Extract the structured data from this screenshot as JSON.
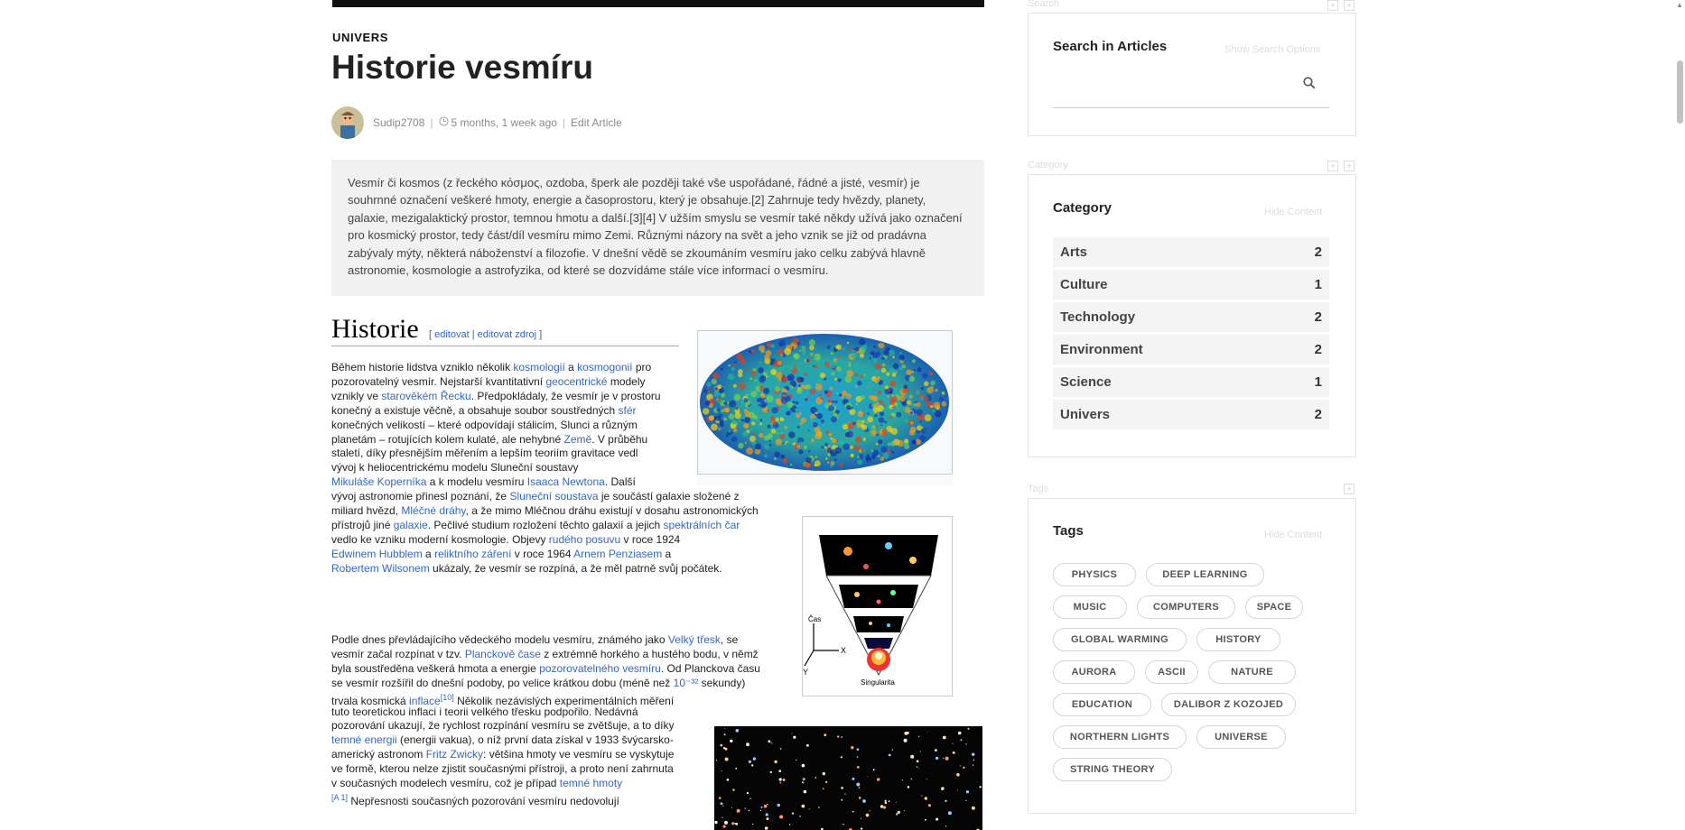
{
  "article": {
    "category": "UNIVERS",
    "title": "Historie vesmíru",
    "author": "Sudip2708",
    "time": "5 months, 1 week ago",
    "edit_link": "Edit Article",
    "summary": "Vesmír či kosmos (z řeckého κόσμος, ozdoba, šperk ale později také vše uspořádané, řádné a jisté, vesmír) je souhrnné označení veškeré hmoty, energie a časoprostoru, který je obsahuje.[2] Zahrnuje tedy hvězdy, planety, galaxie, mezigalaktický prostor, temnou hmotu a další.[3][4] V užším smyslu se vesmír také někdy užívá jako označení pro kosmický prostor, tedy část/díl vesmíru mimo Zemi. Různými názory na svět a jeho vznik se již od pradávna zabývaly mýty, některá náboženství a filozofie. V dnešní vědě se zkoumáním vesmíru jako celku zabývá hlavně astronomie, kosmologie a astrofyzika, od které se dozvídáme stále více informací o vesmíru."
  },
  "wiki": {
    "heading": "Historie",
    "edit_open": "[ ",
    "edit_label": "editovat",
    "edit_sep": " | ",
    "edit_source": "editovat zdroj",
    "edit_close": " ]",
    "p1": [
      [
        [
          "Během historie lidstva vzniklo několik ",
          0
        ],
        [
          "kosmologií",
          1
        ],
        [
          " a ",
          0
        ],
        [
          "kosmogonií",
          1
        ],
        [
          " pro",
          0
        ]
      ],
      [
        [
          "pozorovatelný vesmír. Nejstarší kvantitativní ",
          0
        ],
        [
          "geocentrické",
          1
        ],
        [
          " modely",
          0
        ]
      ],
      [
        [
          "vznikly ve ",
          0
        ],
        [
          "starověkém Řecku",
          1
        ],
        [
          ". Předpokládaly, že vesmír je v prostoru",
          0
        ]
      ],
      [
        [
          "konečný a existuje věčně, a obsahuje soubor soustředných ",
          0
        ],
        [
          "sfér",
          1
        ]
      ],
      [
        [
          " konečných velikostí – které odpovídají stálicím, Slunci a různým",
          0
        ]
      ],
      [
        [
          "planetám – rotujících kolem kulaté, ale nehybné ",
          0
        ],
        [
          "Země",
          1
        ],
        [
          ". V průběhu",
          0
        ]
      ],
      [
        [
          "staletí, díky přesnějším měřením a lepším teoriím gravitace vedl",
          0
        ]
      ],
      [
        [
          "vývoj k heliocentrickému modelu Sluneční soustavy",
          0
        ]
      ],
      [
        [
          "Mikuláše Koperníka",
          1
        ],
        [
          " a k modelu vesmíru ",
          0
        ],
        [
          "Isaaca Newtona",
          1
        ],
        [
          ". Další",
          0
        ]
      ],
      [
        [
          "vývoj astronomie přinesl poznání, že ",
          0
        ],
        [
          "Sluneční soustava",
          1
        ],
        [
          " je součástí galaxie složené z",
          0
        ]
      ],
      [
        [
          "miliard hvězd, ",
          0
        ],
        [
          "Mléčné dráhy",
          1
        ],
        [
          ", a že mimo Mléčnou dráhu existují v dosahu astronomických",
          0
        ]
      ],
      [
        [
          "přístrojů jiné ",
          0
        ],
        [
          "galaxie",
          1
        ],
        [
          ". Pečlivé studium rozložení těchto galaxií a jejich ",
          0
        ],
        [
          "spektrálních čar",
          1
        ]
      ],
      [
        [
          " vedlo ke vzniku moderní kosmologie. Objevy ",
          0
        ],
        [
          "rudého posuvu",
          1
        ],
        [
          " v roce 1924",
          0
        ]
      ],
      [
        [
          "Edwinem Hubblem",
          1
        ],
        [
          " a ",
          0
        ],
        [
          "reliktního záření",
          1
        ],
        [
          " v roce 1964 ",
          0
        ],
        [
          "Arnem Penziasem",
          1
        ],
        [
          " a",
          0
        ]
      ],
      [
        [
          "Robertem Wilsonem",
          1
        ],
        [
          " ukázaly, že vesmír se rozpíná, a že měl patrně svůj počátek.",
          0
        ]
      ]
    ],
    "p2": [
      [
        [
          "Podle dnes převládajícího vědeckého modelu vesmíru, známého jako ",
          0
        ],
        [
          "Velký třesk",
          1
        ],
        [
          ", se",
          0
        ]
      ],
      [
        [
          "vesmír začal rozpínat v tzv. ",
          0
        ],
        [
          "Planckově čase",
          1
        ],
        [
          " z extrémně horkého a hustého bodu, v němž",
          0
        ]
      ],
      [
        [
          "byla soustředěna veškerá hmota a energie ",
          0
        ],
        [
          "pozorovatelného vesmíru",
          1
        ],
        [
          ". Od Planckova času",
          0
        ]
      ],
      [
        [
          "se vesmír rozšířil do dnešní podoby, po velice krátkou dobu (méně než ",
          0
        ],
        [
          "10⁻³²",
          1
        ],
        [
          " sekundy)",
          0
        ]
      ],
      [
        [
          "trvala kosmická ",
          0
        ],
        [
          "inflace",
          1
        ],
        [
          "[10]",
          2
        ],
        [
          " Několik nezávislých experimentálních měření",
          0
        ]
      ],
      [
        [
          "tuto teoretickou inflaci i teorii velkého třesku podpořilo. Nedávná",
          0
        ]
      ],
      [
        [
          "pozorování ukazují, že rychlost rozpínání vesmíru se zvětšuje, a to díky",
          0
        ]
      ],
      [
        [
          "temné energii",
          1
        ],
        [
          " (energii vakua), o níž první data získal v 1933 švýcarsko-",
          0
        ]
      ],
      [
        [
          "americký astronom ",
          0
        ],
        [
          "Fritz Zwicky",
          1
        ],
        [
          ": většina hmoty ve vesmíru se vyskytuje",
          0
        ]
      ],
      [
        [
          "ve formě, kterou nelze zjistit současnými přístroji, a proto není zahrnuta",
          0
        ]
      ],
      [
        [
          "v současných modelech vesmíru, což je případ ",
          0
        ],
        [
          "temné hmoty",
          1
        ]
      ],
      [
        [
          " ",
          0
        ],
        [
          "[A 1]",
          2
        ],
        [
          " Nepřesnosti současných pozorování vesmíru nedovolují",
          0
        ]
      ]
    ],
    "fig2_labels": {
      "time": "Čas",
      "x": "X",
      "y": "Y",
      "singularity": "Singularita"
    }
  },
  "sidebar": {
    "search_widget_label": "Search",
    "search_title": "Search in Articles",
    "search_hint": "Show Search Options",
    "category_widget_label": "Category",
    "category_title": "Category",
    "category_hint": "Hide Content",
    "categories": [
      {
        "name": "Arts",
        "count": "2"
      },
      {
        "name": "Culture",
        "count": "1"
      },
      {
        "name": "Technology",
        "count": "2"
      },
      {
        "name": "Environment",
        "count": "2"
      },
      {
        "name": "Science",
        "count": "1"
      },
      {
        "name": "Univers",
        "count": "2"
      }
    ],
    "tags_widget_label": "Tags",
    "tags_title": "Tags",
    "tags_hint": "Hide Content",
    "tags": [
      "PHYSICS",
      "DEEP LEARNING",
      "MUSIC",
      "COMPUTERS",
      "SPACE",
      "GLOBAL WARMING",
      "HISTORY",
      "AURORA",
      "ASCII",
      "NATURE",
      "EDUCATION",
      "DALIBOR Z KOZOJED",
      "NORTHERN LIGHTS",
      "UNIVERSE",
      "STRING THEORY"
    ]
  },
  "colors": {
    "link": "#3366cc",
    "panel_border": "#e4e4e4",
    "category_bg": "#f4f4f5"
  }
}
